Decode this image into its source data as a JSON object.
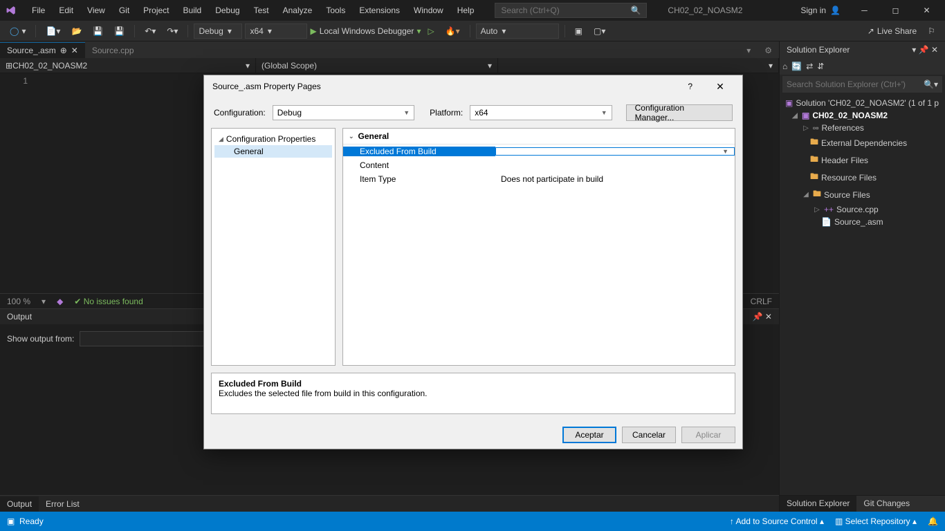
{
  "menu": [
    "File",
    "Edit",
    "View",
    "Git",
    "Project",
    "Build",
    "Debug",
    "Test",
    "Analyze",
    "Tools",
    "Extensions",
    "Window",
    "Help"
  ],
  "search_placeholder": "Search (Ctrl+Q)",
  "project_title": "CH02_02_NOASM2",
  "signin": "Sign in",
  "toolbar": {
    "config": "Debug",
    "platform": "x64",
    "run": "Local Windows Debugger",
    "auto": "Auto",
    "live_share": "Live Share"
  },
  "tabs": {
    "active": "Source_.asm",
    "inactive": "Source.cpp"
  },
  "nav": {
    "left": "CH02_02_NOASM2",
    "middle": "(Global Scope)"
  },
  "gutter_line": "1",
  "editor_status": {
    "zoom": "100 %",
    "issues": "No issues found",
    "eol": "CRLF"
  },
  "output": {
    "title": "Output",
    "show_from": "Show output from:"
  },
  "panels": {
    "output": "Output",
    "errorlist": "Error List"
  },
  "solution_explorer": {
    "title": "Solution Explorer",
    "search_placeholder": "Search Solution Explorer (Ctrl+')",
    "solution": "Solution 'CH02_02_NOASM2' (1 of 1 p",
    "project": "CH02_02_NOASM2",
    "references": "References",
    "external": "External Dependencies",
    "header": "Header Files",
    "resource": "Resource Files",
    "source": "Source Files",
    "cpp": "Source.cpp",
    "asm": "Source_.asm",
    "tab_se": "Solution Explorer",
    "tab_git": "Git Changes"
  },
  "statusbar": {
    "ready": "Ready",
    "add_sc": "Add to Source Control",
    "select_repo": "Select Repository"
  },
  "dialog": {
    "title": "Source_.asm Property Pages",
    "configuration_lbl": "Configuration:",
    "configuration_val": "Debug",
    "platform_lbl": "Platform:",
    "platform_val": "x64",
    "config_mgr": "Configuration Manager...",
    "tree_root": "Configuration Properties",
    "tree_general": "General",
    "section": "General",
    "props": {
      "excluded": "Excluded From Build",
      "content": "Content",
      "item_type": "Item Type",
      "item_type_val": "Does not participate in build"
    },
    "help_title": "Excluded From Build",
    "help_text": "Excludes the selected file from build in this configuration.",
    "ok": "Aceptar",
    "cancel": "Cancelar",
    "apply": "Aplicar"
  }
}
